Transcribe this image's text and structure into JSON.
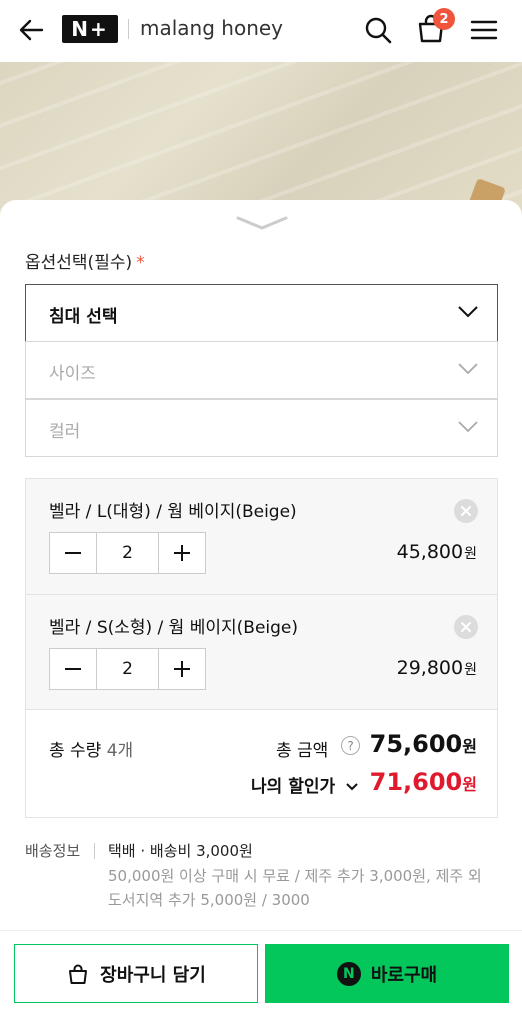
{
  "header": {
    "logo_text": "N+",
    "brand": "malang honey",
    "cart_count": "2"
  },
  "options": {
    "label": "옵션선택(필수)",
    "required_mark": "*",
    "selects": [
      {
        "label": "침대 선택",
        "state": "active"
      },
      {
        "label": "사이즈",
        "state": "disabled"
      },
      {
        "label": "컬러",
        "state": "disabled"
      }
    ]
  },
  "cart_items": [
    {
      "name": "벨라 / L(대형) / 웜 베이지(Beige)",
      "qty": "2",
      "price": "45,800",
      "unit": "원"
    },
    {
      "name": "벨라 / S(소형) / 웜 베이지(Beige)",
      "qty": "2",
      "price": "29,800",
      "unit": "원"
    }
  ],
  "totals": {
    "qty_label": "총 수량",
    "qty_value": "4개",
    "amount_label": "총 금액",
    "help": "?",
    "amount_value": "75,600",
    "unit": "원",
    "discount_label": "나의 할인가",
    "discount_value": "71,600"
  },
  "shipping": {
    "label": "배송정보",
    "line1": "택배 · 배송비 3,000원",
    "line2": "50,000원 이상 구매 시 무료 / 제주 추가 3,000원, 제주 외 도서지역 추가 5,000원 / 3000"
  },
  "actions": {
    "cart_label": "장바구니 담기",
    "buy_label": "바로구매",
    "npay_mark": "N"
  },
  "colors": {
    "accent": "#03c75a",
    "discount": "#e01a2e",
    "badge": "#f0543c"
  }
}
